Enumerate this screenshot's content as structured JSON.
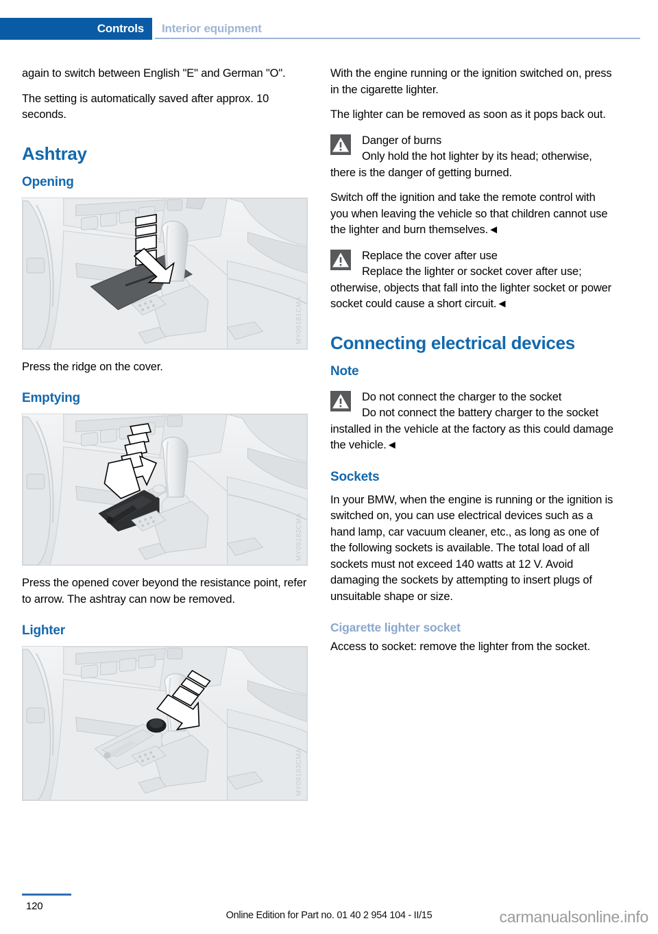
{
  "header": {
    "tab_label": "Controls",
    "section_label": "Interior equipment"
  },
  "left_column": {
    "para_continued": "again to switch between English \"E\" and German \"O\".",
    "para_saved": "The setting is automatically saved after approx. 10 seconds.",
    "heading_ashtray": "Ashtray",
    "heading_opening": "Opening",
    "figure_opening_code": "MY09181CMA",
    "caption_opening": "Press the ridge on the cover.",
    "heading_emptying": "Emptying",
    "figure_emptying_code": "MY09182CMA",
    "caption_emptying": "Press the opened cover beyond the resistance point, refer to arrow. The ashtray can now be removed.",
    "heading_lighter": "Lighter",
    "figure_lighter_code": "MY09183CMA"
  },
  "right_column": {
    "para_press_in": "With the engine running or the ignition switched on, press in the cigarette lighter.",
    "para_pops_out": "The lighter can be removed as soon as it pops back out.",
    "warning_burns": {
      "icon": "warning-triangle-icon",
      "title": "Danger of burns",
      "body": "Only hold the hot lighter by its head; otherwise, there is the danger of getting burned."
    },
    "para_switch_off": "Switch off the ignition and take the remote control with you when leaving the vehicle so that children cannot use the lighter and burn themselves.◄",
    "warning_replace_cover": {
      "icon": "warning-triangle-icon",
      "title": "Replace the cover after use",
      "body": "Replace the lighter or socket cover after use; otherwise, objects that fall into the lighter socket or power socket could cause a short circuit.◄"
    },
    "heading_connecting": "Connecting electrical devices",
    "heading_note": "Note",
    "note_charger": {
      "icon": "warning-triangle-icon",
      "title": "Do not connect the charger to the socket",
      "body": "Do not connect the battery charger to the socket installed in the vehicle at the factory as this could damage the vehicle.◄"
    },
    "heading_sockets": "Sockets",
    "para_sockets": "In your BMW, when the engine is running or the ignition is switched on, you can use electrical devices such as a hand lamp, car vacuum cleaner, etc., as long as one of the following sockets is available. The total load of all sockets must not exceed 140 watts at 12 V. Avoid damaging the sockets by attempting to insert plugs of unsuitable shape or size.",
    "heading_cigarette_socket": "Cigarette lighter socket",
    "para_access": "Access to socket: remove the lighter from the socket."
  },
  "footer": {
    "page_number": "120",
    "edition_text": "Online Edition for Part no. 01 40 2 954 104 - II/15",
    "watermark": "carmanualsonline.info"
  },
  "colors": {
    "header_tab_bg": "#0a5ba5",
    "header_section_text": "#9fb4d4",
    "heading_blue": "#1268ad",
    "minor_heading_blue": "#8ba7cd",
    "warning_icon_bg": "#58595b",
    "footer_rule": "#2f6fb5"
  }
}
